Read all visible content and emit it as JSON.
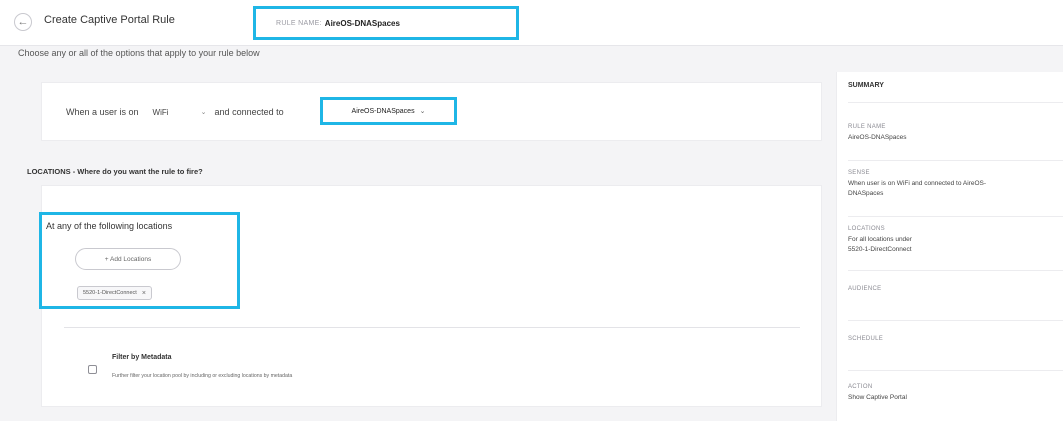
{
  "header": {
    "back_icon": "arrow-left-icon",
    "title": "Create Captive Portal Rule",
    "rule_name_label": "RULE NAME:",
    "rule_name_value": "AireOS-DNASpaces"
  },
  "instruction": "Choose any or all of the options that apply to your rule below",
  "when": {
    "prefix": "When a user is on",
    "sense_value": "WiFi",
    "connected_label": "and connected to",
    "network_value": "AireOS-DNASpaces"
  },
  "locations": {
    "heading": "LOCATIONS - Where do you want the rule to fire?",
    "box_title": "At any of the following locations",
    "add_button": "+ Add Locations",
    "chip_label": "5520-1-DirectConnect",
    "filter_title": "Filter by Metadata",
    "filter_desc": "Further filter your location pool by including or excluding locations by metadata"
  },
  "summary": {
    "title": "SUMMARY",
    "rule_name_label": "RULE NAME",
    "rule_name_value": "AireOS-DNASpaces",
    "sense_label": "SENSE",
    "sense_value_1": "When user is on WiFi and connected to AireOS-",
    "sense_value_2": "DNASpaces",
    "locations_label": "LOCATIONS",
    "locations_value_1": "For all locations under",
    "locations_value_2": "5520-1-DirectConnect",
    "audience_label": "AUDIENCE",
    "schedule_label": "SCHEDULE",
    "action_label": "ACTION",
    "action_value": "Show Captive Portal"
  },
  "colors": {
    "highlight": "#1fb6e6",
    "background": "#f4f4f6"
  }
}
